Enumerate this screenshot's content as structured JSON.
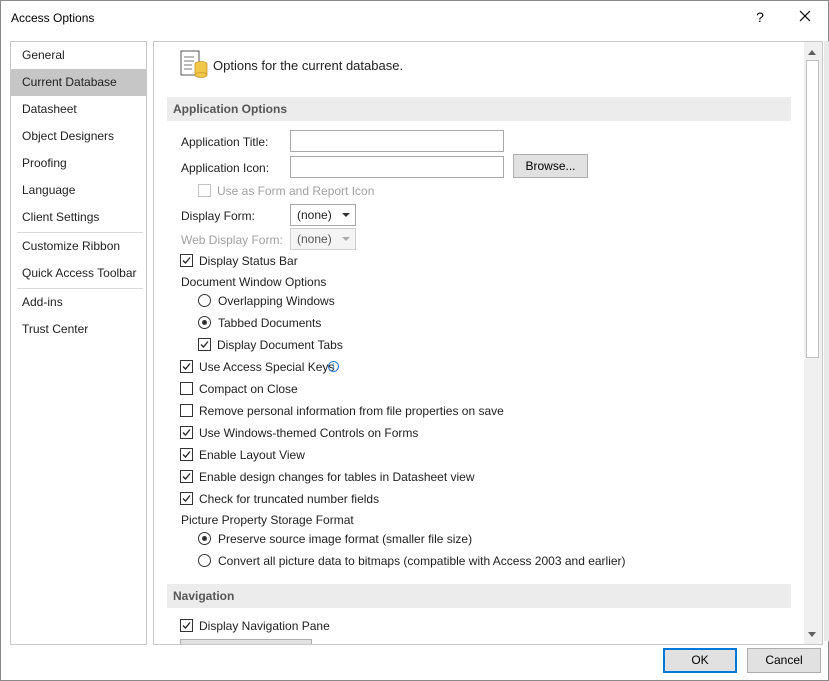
{
  "window": {
    "title": "Access Options",
    "help_glyph": "?"
  },
  "sidebar": {
    "items": [
      {
        "label": "General"
      },
      {
        "label": "Current Database"
      },
      {
        "label": "Datasheet"
      },
      {
        "label": "Object Designers"
      },
      {
        "label": "Proofing"
      },
      {
        "label": "Language"
      },
      {
        "label": "Client Settings"
      },
      {
        "label": "Customize Ribbon"
      },
      {
        "label": "Quick Access Toolbar"
      },
      {
        "label": "Add-ins"
      },
      {
        "label": "Trust Center"
      }
    ],
    "selected": "Current Database"
  },
  "content": {
    "header": "Options for the current database.",
    "header_icon": "database-options-icon",
    "app_options": {
      "section_title": "Application Options",
      "app_title_label": "Application Title:",
      "app_title_value": "",
      "app_icon_label": "Application Icon:",
      "app_icon_value": "",
      "browse_label": "Browse...",
      "use_as_icon_label": "Use as Form and Report Icon",
      "display_form_label": "Display Form:",
      "display_form_value": "(none)",
      "web_display_form_label": "Web Display Form:",
      "web_display_form_value": "(none)",
      "display_status_bar": "Display Status Bar",
      "doc_window_options": "Document Window Options",
      "overlapping_windows": "Overlapping Windows",
      "tabbed_documents": "Tabbed Documents",
      "display_document_tabs": "Display Document Tabs",
      "use_access_special_keys": "Use Access Special Keys",
      "compact_on_close": "Compact on Close",
      "remove_personal_info": "Remove personal information from file properties on save",
      "use_windows_themed": "Use Windows-themed Controls on Forms",
      "enable_layout_view": "Enable Layout View",
      "enable_design_changes": "Enable design changes for tables in Datasheet view",
      "check_truncated": "Check for truncated number fields",
      "picture_storage_format": "Picture Property Storage Format",
      "preserve_source": "Preserve source image format (smaller file size)",
      "convert_all": "Convert all picture data to bitmaps (compatible with Access 2003 and earlier)"
    },
    "navigation": {
      "section_title": "Navigation",
      "display_nav_pane": "Display Navigation Pane"
    }
  },
  "states": {
    "use_as_icon": false,
    "display_status_bar": true,
    "overlapping_windows": false,
    "tabbed_documents": true,
    "display_document_tabs": true,
    "use_access_special_keys": true,
    "compact_on_close": false,
    "remove_personal_info": false,
    "use_windows_themed": true,
    "enable_layout_view": true,
    "enable_design_changes": true,
    "check_truncated": true,
    "preserve_source": true,
    "convert_all": false,
    "display_nav_pane": true
  },
  "footer": {
    "ok_label": "OK",
    "cancel_label": "Cancel"
  }
}
